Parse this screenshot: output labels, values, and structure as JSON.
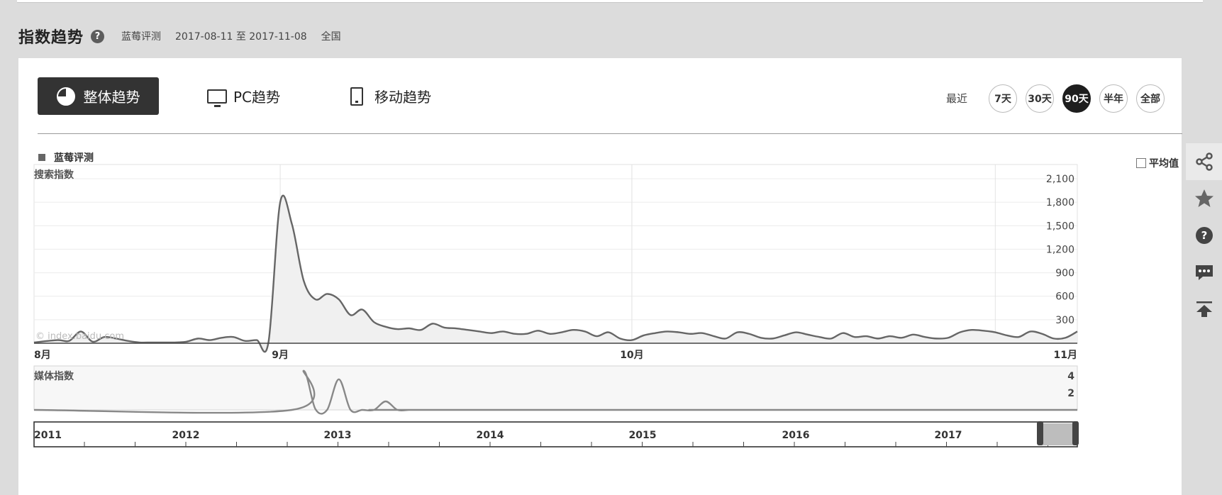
{
  "header": {
    "title": "指数趋势",
    "keyword": "蓝莓评测",
    "date_range": "2017-08-11 至 2017-11-08",
    "region": "全国"
  },
  "tabs": [
    {
      "label": "整体趋势",
      "icon": "pie-chart-icon",
      "active": true
    },
    {
      "label": "PC趋势",
      "icon": "monitor-icon",
      "active": false
    },
    {
      "label": "移动趋势",
      "icon": "mobile-icon",
      "active": false
    }
  ],
  "range": {
    "label": "最近",
    "options": [
      "7天",
      "30天",
      "90天",
      "半年",
      "全部"
    ],
    "selected": "90天"
  },
  "legend": {
    "series": "蓝莓评测",
    "avg_label": "平均值",
    "avg_checked": false
  },
  "watermark": "© index.baidu.com",
  "side_tools": [
    "share-icon",
    "star-icon",
    "help-icon",
    "comment-icon",
    "back-to-top-icon"
  ],
  "chart_data": [
    {
      "type": "area",
      "ylabel": "搜索指数",
      "yticks": [
        300,
        600,
        900,
        1200,
        1500,
        1800,
        2100
      ],
      "ylim": [
        0,
        2100
      ],
      "x_tick_labels": [
        "8月",
        "9月",
        "10月",
        "11月"
      ],
      "x_start": "2017-08-11",
      "x_end": "2017-11-08",
      "series": [
        {
          "name": "蓝莓评测",
          "x": [
            0,
            2,
            3,
            4,
            5,
            6,
            7,
            8,
            9,
            10,
            11,
            12,
            13,
            14,
            15,
            16,
            17,
            18,
            19,
            20,
            21,
            22,
            23,
            24,
            25,
            26,
            27,
            28,
            29,
            30,
            31,
            32,
            33,
            34,
            35,
            36,
            37,
            38,
            39,
            40,
            41,
            42,
            43,
            44,
            45,
            46,
            47,
            48,
            49,
            50,
            51,
            52,
            53,
            54,
            55,
            56,
            57,
            58,
            59,
            60,
            61,
            62,
            63,
            64,
            65,
            66,
            67,
            68,
            69,
            70,
            71,
            72,
            73,
            74,
            75,
            76,
            77,
            78,
            79,
            80,
            81,
            82,
            83,
            84,
            85,
            86,
            87,
            88,
            89
          ],
          "values": [
            10,
            40,
            30,
            150,
            20,
            80,
            60,
            30,
            10,
            10,
            10,
            10,
            20,
            60,
            40,
            70,
            80,
            30,
            40,
            15,
            1800,
            1520,
            800,
            560,
            630,
            560,
            360,
            430,
            270,
            210,
            180,
            190,
            170,
            250,
            200,
            190,
            170,
            150,
            130,
            150,
            120,
            120,
            160,
            120,
            140,
            170,
            150,
            90,
            140,
            60,
            40,
            100,
            130,
            150,
            140,
            120,
            130,
            90,
            60,
            140,
            120,
            70,
            60,
            100,
            140,
            110,
            80,
            60,
            130,
            80,
            90,
            60,
            90,
            70,
            110,
            80,
            60,
            70,
            140,
            170,
            160,
            140,
            100,
            80,
            150,
            120,
            60,
            70,
            150
          ],
          "color": "#666666"
        }
      ]
    },
    {
      "type": "area",
      "ylabel": "媒体指数",
      "yticks": [
        2,
        4
      ],
      "ylim": [
        0,
        4
      ],
      "series": [
        {
          "name": "蓝莓评测",
          "x": [
            0,
            22,
            23,
            24,
            25,
            26,
            27,
            28,
            29,
            30,
            31,
            32,
            33,
            89
          ],
          "values": [
            0,
            0,
            4.6,
            0.1,
            0,
            3.6,
            0,
            0,
            0,
            1,
            0,
            0,
            0,
            0
          ],
          "color": "#888888"
        }
      ]
    },
    {
      "type": "area",
      "x_tick_labels": [
        "2011",
        "2012",
        "2013",
        "2014",
        "2015",
        "2016",
        "2017"
      ]
    }
  ]
}
